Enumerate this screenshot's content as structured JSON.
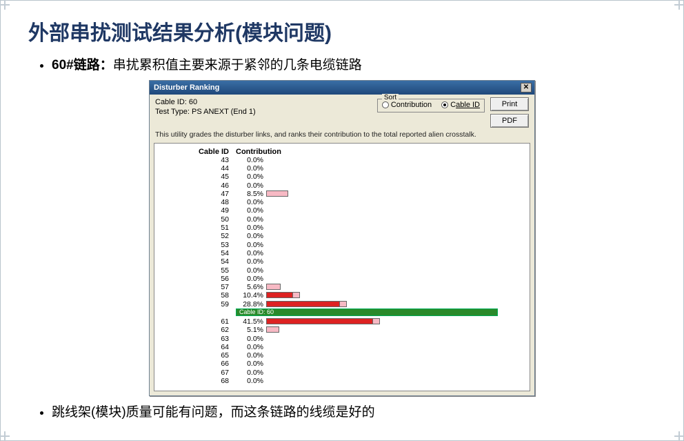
{
  "title": "外部串扰测试结果分析(模块问题)",
  "bullets": {
    "b1_lead": "60#链路：",
    "b1_rest": "串扰累积值主要来源于紧邻的几条电缆链路",
    "b2": "跳线架(模块)质量可能有问题，而这条链路的线缆是好的"
  },
  "dialog": {
    "title": "Disturber Ranking",
    "cable_id_line": "Cable ID: 60",
    "test_type_line": "Test Type: PS ANEXT (End 1)",
    "sort_label": "Sort",
    "sort_opt_contribution": "Contribution",
    "sort_opt_cableid_pre": "C",
    "sort_opt_cableid_underlined": "able ID",
    "btn_print": "Print",
    "btn_pdf": "PDF",
    "desc": "This utility grades the disturber links, and ranks their contribution to the total reported alien crosstalk.",
    "hdr_cableid": "Cable ID",
    "hdr_contribution": "Contribution",
    "highlight_label": "Cable ID: 60"
  },
  "chart_data": {
    "type": "bar",
    "xlabel": "Contribution (%)",
    "ylabel": "Cable ID",
    "highlight_cable": 60,
    "max_bar_percent": 41.5,
    "rows": [
      {
        "cable_id": "43",
        "contribution": 0.0
      },
      {
        "cable_id": "44",
        "contribution": 0.0
      },
      {
        "cable_id": "45",
        "contribution": 0.0
      },
      {
        "cable_id": "46",
        "contribution": 0.0
      },
      {
        "cable_id": "47",
        "contribution": 8.5
      },
      {
        "cable_id": "48",
        "contribution": 0.0
      },
      {
        "cable_id": "49",
        "contribution": 0.0
      },
      {
        "cable_id": "50",
        "contribution": 0.0
      },
      {
        "cable_id": "51",
        "contribution": 0.0
      },
      {
        "cable_id": "52",
        "contribution": 0.0
      },
      {
        "cable_id": "53",
        "contribution": 0.0
      },
      {
        "cable_id": "54",
        "contribution": 0.0
      },
      {
        "cable_id": "54",
        "contribution": 0.0
      },
      {
        "cable_id": "55",
        "contribution": 0.0
      },
      {
        "cable_id": "56",
        "contribution": 0.0
      },
      {
        "cable_id": "57",
        "contribution": 5.6
      },
      {
        "cable_id": "58",
        "contribution": 10.4
      },
      {
        "cable_id": "59",
        "contribution": 28.8
      },
      {
        "cable_id": "HIGHLIGHT",
        "contribution": null
      },
      {
        "cable_id": "61",
        "contribution": 41.5
      },
      {
        "cable_id": "62",
        "contribution": 5.1
      },
      {
        "cable_id": "63",
        "contribution": 0.0
      },
      {
        "cable_id": "64",
        "contribution": 0.0
      },
      {
        "cable_id": "65",
        "contribution": 0.0
      },
      {
        "cable_id": "66",
        "contribution": 0.0
      },
      {
        "cable_id": "67",
        "contribution": 0.0
      },
      {
        "cable_id": "68",
        "contribution": 0.0
      }
    ]
  }
}
